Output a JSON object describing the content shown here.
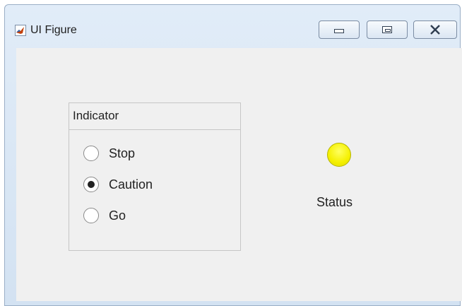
{
  "window": {
    "title": "UI Figure",
    "icon": "matlab-logo-icon"
  },
  "title_buttons": {
    "minimize": "minimize-icon",
    "maximize": "maximize-icon",
    "close": "close-icon"
  },
  "indicator_panel": {
    "title": "Indicator",
    "options": [
      {
        "label": "Stop",
        "selected": false
      },
      {
        "label": "Caution",
        "selected": true
      },
      {
        "label": "Go",
        "selected": false
      }
    ]
  },
  "status_lamp": {
    "label": "Status",
    "color": "#f5f000"
  },
  "colors": {
    "client_background": "#f0f0f0",
    "titlebar": "#d3e2f2"
  }
}
